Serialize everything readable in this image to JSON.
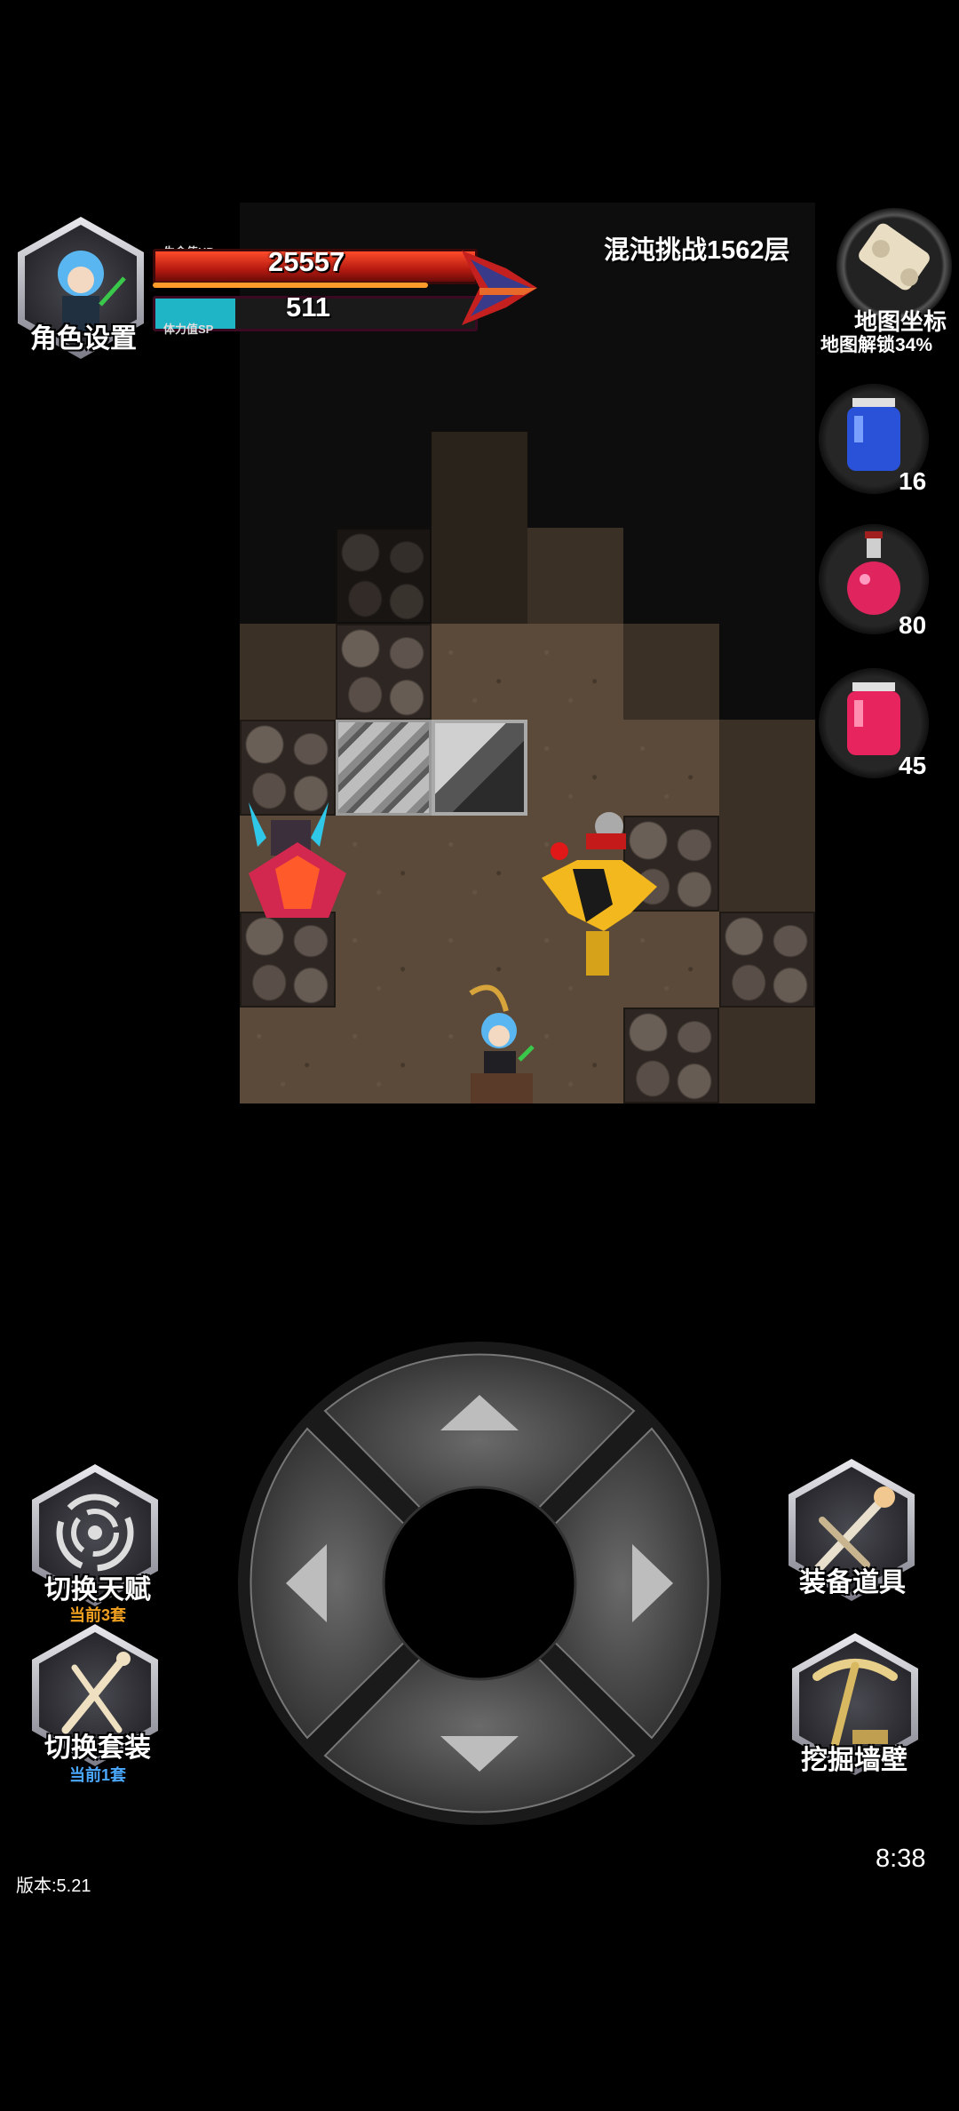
{
  "hud": {
    "hp_label": "生命值HP",
    "hp_value": "25557",
    "sp_label": "体力值SP",
    "sp_value": "511",
    "sp_fill_fraction": 0.25
  },
  "character_button": {
    "label": "角色设置",
    "icon": "hero-portrait-icon"
  },
  "challenge_title": "混沌挑战1562层",
  "map_button": {
    "label": "地图坐标",
    "unlock_text": "地图解锁34%",
    "icon": "scroll-icon"
  },
  "potions": [
    {
      "name": "blue-potion-icon",
      "count": "16",
      "color": "#2a52d8"
    },
    {
      "name": "red-potion-icon",
      "count": "80",
      "color": "#e0245e"
    },
    {
      "name": "pink-potion-icon",
      "count": "45",
      "color": "#e8245e"
    }
  ],
  "left_buttons": [
    {
      "label": "切换天赋",
      "sub": "当前3套",
      "sub_color": "#f0a020",
      "icon": "vortex-icon"
    },
    {
      "label": "切换套装",
      "sub": "当前1套",
      "sub_color": "#4aa8ff",
      "icon": "bone-set-icon"
    }
  ],
  "right_buttons": [
    {
      "label": "装备道具",
      "icon": "sword-icon"
    },
    {
      "label": "挖掘墙壁",
      "icon": "pickaxe-icon"
    }
  ],
  "dpad": {
    "up": "up-arrow-icon",
    "down": "down-arrow-icon",
    "left": "left-arrow-icon",
    "right": "right-arrow-icon"
  },
  "clock": "8:38",
  "version": "版本:5.21"
}
